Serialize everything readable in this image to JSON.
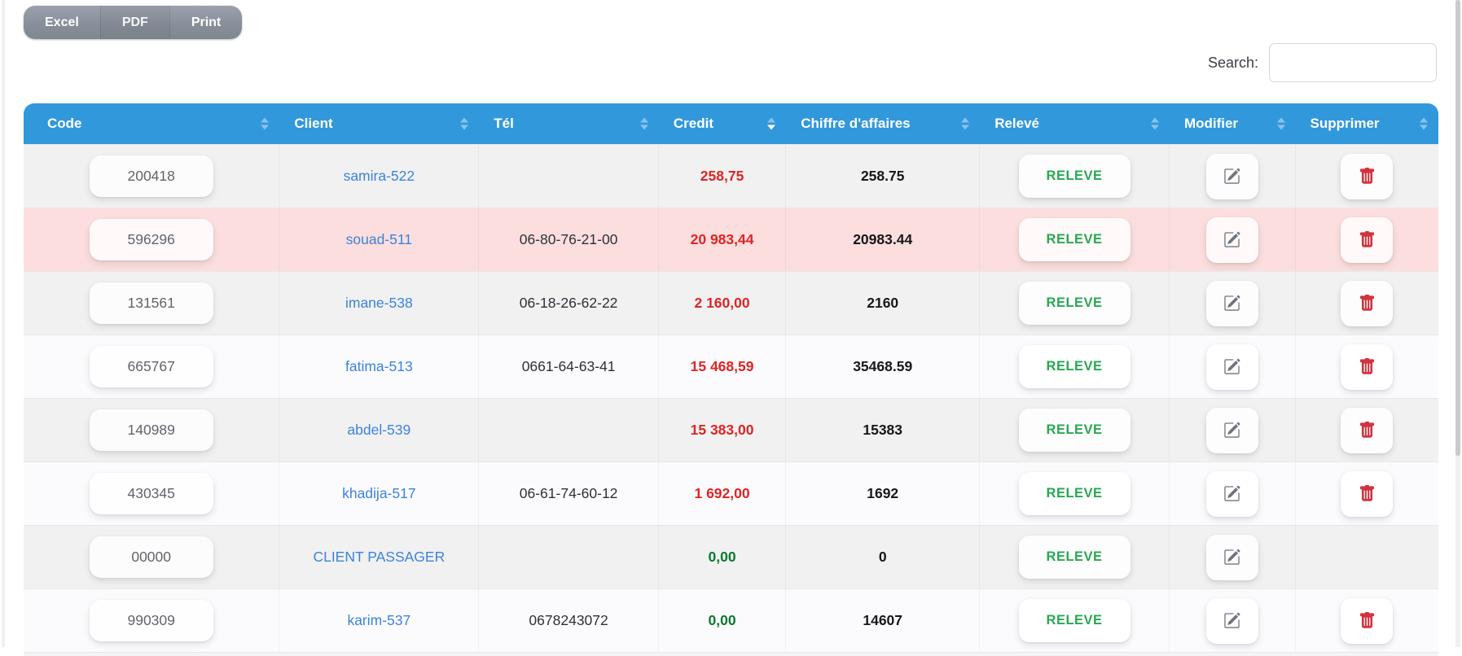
{
  "export_buttons": [
    {
      "label": "Excel"
    },
    {
      "label": "PDF"
    },
    {
      "label": "Print"
    }
  ],
  "search": {
    "label": "Search:",
    "value": "",
    "placeholder": ""
  },
  "table": {
    "columns": [
      {
        "label": "Code",
        "sort": "none"
      },
      {
        "label": "Client",
        "sort": "none"
      },
      {
        "label": "Tél",
        "sort": "none"
      },
      {
        "label": "Credit",
        "sort": "desc"
      },
      {
        "label": "Chiffre d'affaires",
        "sort": "none"
      },
      {
        "label": "Relevé",
        "sort": "none"
      },
      {
        "label": "Modifier",
        "sort": "none"
      },
      {
        "label": "Supprimer",
        "sort": "none"
      }
    ],
    "rows": [
      {
        "code": "200418",
        "client": "samira-522",
        "tel": "",
        "credit": "258,75",
        "credit_color": "red",
        "chiffre": "258.75",
        "releve": "RELEVE",
        "highlight": false,
        "has_delete": true
      },
      {
        "code": "596296",
        "client": "souad-511",
        "tel": "06-80-76-21-00",
        "credit": "20 983,44",
        "credit_color": "red",
        "chiffre": "20983.44",
        "releve": "RELEVE",
        "highlight": true,
        "has_delete": true
      },
      {
        "code": "131561",
        "client": "imane-538",
        "tel": "06-18-26-62-22",
        "credit": "2 160,00",
        "credit_color": "red",
        "chiffre": "2160",
        "releve": "RELEVE",
        "highlight": false,
        "has_delete": true
      },
      {
        "code": "665767",
        "client": "fatima-513",
        "tel": "0661-64-63-41",
        "credit": "15 468,59",
        "credit_color": "red",
        "chiffre": "35468.59",
        "releve": "RELEVE",
        "highlight": false,
        "has_delete": true
      },
      {
        "code": "140989",
        "client": "abdel-539",
        "tel": "",
        "credit": "15 383,00",
        "credit_color": "red",
        "chiffre": "15383",
        "releve": "RELEVE",
        "highlight": false,
        "has_delete": true
      },
      {
        "code": "430345",
        "client": "khadija-517",
        "tel": "06-61-74-60-12",
        "credit": "1 692,00",
        "credit_color": "red",
        "chiffre": "1692",
        "releve": "RELEVE",
        "highlight": false,
        "has_delete": true
      },
      {
        "code": "00000",
        "client": "CLIENT PASSAGER",
        "tel": "",
        "credit": "0,00",
        "credit_color": "green",
        "chiffre": "0",
        "releve": "RELEVE",
        "highlight": false,
        "has_delete": false
      },
      {
        "code": "990309",
        "client": "karim-537",
        "tel": "0678243072",
        "credit": "0,00",
        "credit_color": "green",
        "chiffre": "14607",
        "releve": "RELEVE",
        "highlight": false,
        "has_delete": true
      }
    ]
  },
  "icons": {
    "edit": "pencil-square",
    "delete": "trash",
    "sort": "up-down-arrows"
  },
  "colors": {
    "header_bg": "#3298dc",
    "row_odd": "#f1f1f2",
    "row_even": "#fbfbfd",
    "row_highlight": "#fcdede",
    "credit_red": "#e02424",
    "credit_green": "#0b7a2d",
    "releve_green": "#28a852",
    "link_blue": "#3c83dc",
    "delete_red": "#d2333f",
    "export_button_bg": "#878f99"
  }
}
